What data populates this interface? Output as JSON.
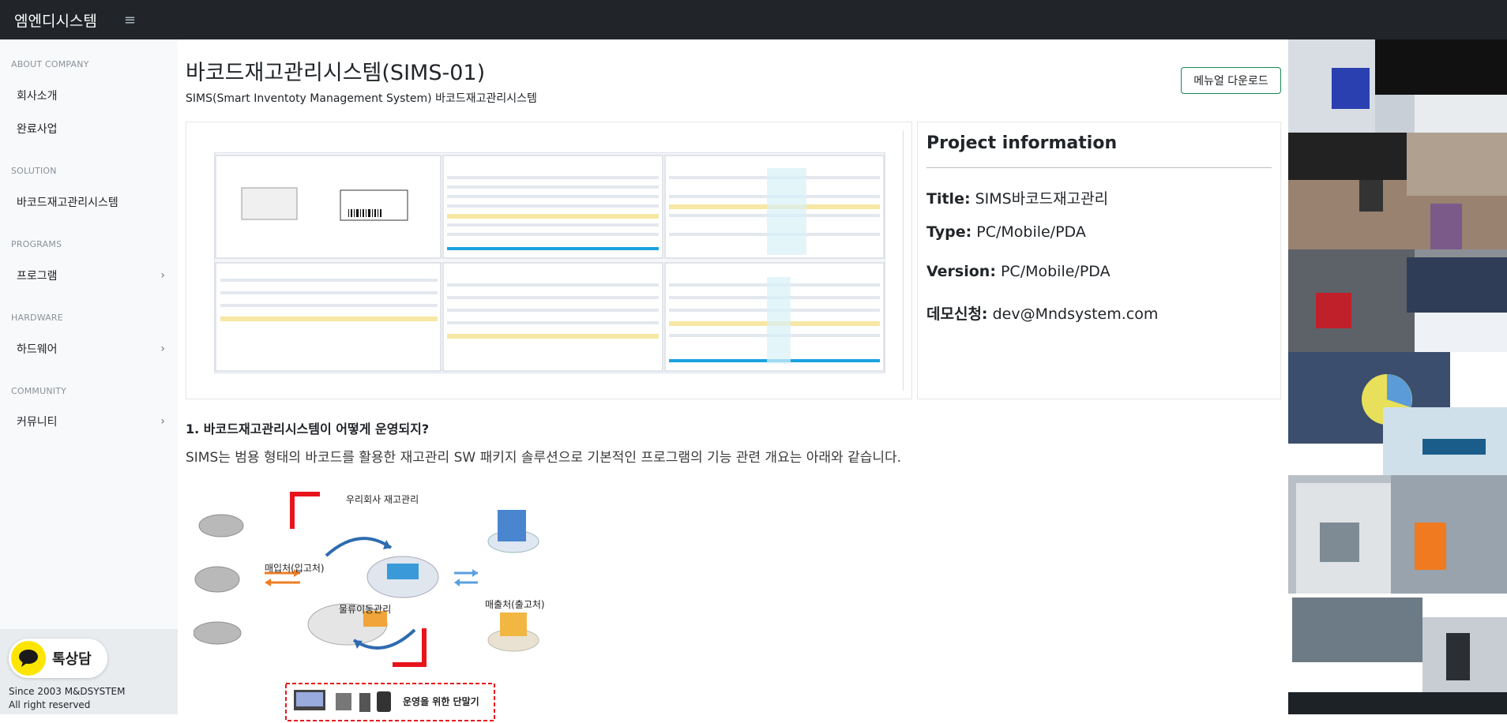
{
  "topbar": {
    "brand": "엠엔디시스템",
    "menu_icon": "hamburger-icon"
  },
  "sidebar": {
    "sections": [
      {
        "title": "ABOUT COMPANY",
        "items": [
          {
            "label": "회사소개"
          },
          {
            "label": "완료사업"
          }
        ]
      },
      {
        "title": "SOLUTION",
        "items": [
          {
            "label": "바코드재고관리시스템"
          }
        ]
      },
      {
        "title": "PROGRAMS",
        "items": [
          {
            "label": "프로그램",
            "expandable": true
          }
        ]
      },
      {
        "title": "HARDWARE",
        "items": [
          {
            "label": "하드웨어",
            "expandable": true
          }
        ]
      },
      {
        "title": "COMMUNITY",
        "items": [
          {
            "label": "커뮤니티",
            "expandable": true
          }
        ]
      }
    ],
    "chat_button": "톡상담",
    "footer_line1": "Since 2003 M&DSYSTEM",
    "footer_line2": "All right reserved"
  },
  "main": {
    "title": "바코드재고관리시스템(SIMS-01)",
    "subtitle": "SIMS(Smart Inventoty Management System) 바코드재고관리시스템",
    "download_button": "메뉴얼 다운로드",
    "project": {
      "heading": "Project information",
      "rows": [
        {
          "key": "Title:",
          "value": "SIMS바코드재고관리"
        },
        {
          "key": "Type:",
          "value": "PC/Mobile/PDA"
        },
        {
          "key": "Version:",
          "value": "PC/Mobile/PDA"
        },
        {
          "key": "데모신청:",
          "value": "dev@Mndsystem.com"
        }
      ]
    },
    "section1": {
      "heading": "1. 바코드재고관리시스템이 어떻게 운영되지?",
      "text": "SIMS는 범용 형태의 바코드를 활용한 재고관리 SW 패키지 솔루션으로 기본적인 프로그램의 기능 관련 개요는 아래와 같습니다."
    },
    "diagram": {
      "our_company": "우리회사 재고관리",
      "purchase": "매입처(입고처)",
      "logistics": "물류이동관리",
      "sales": "매출처(출고처)",
      "devices": "운영을 위한 단말기"
    }
  },
  "colors": {
    "topbar": "#212529",
    "sidebar": "#f8f9fa",
    "accent_green": "#198754",
    "kakao_yellow": "#fee500",
    "diagram_red": "#e8141c",
    "diagram_blue": "#2e6bb0",
    "diagram_orange": "#ef7d22"
  }
}
